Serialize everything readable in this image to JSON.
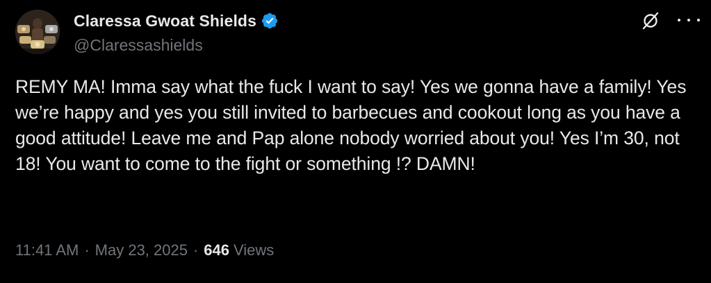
{
  "tweet": {
    "author": {
      "display_name": "Claressa Gwoat Shields",
      "handle": "@Claressashields",
      "verified": true
    },
    "text": "REMY MA! Imma say what the fuck I want to say! Yes we gonna have a family! Yes we’re happy and yes you still invited to barbecues and cookout long as you have a good attitude! Leave me and Pap alone nobody worried about you! Yes I’m 30, not 18! You want to come to the fight or something !? DAMN!",
    "time": "11:41 AM",
    "date": "May 23, 2025",
    "separator": "·",
    "views_count": "646",
    "views_label": "Views"
  },
  "icons": {
    "verified": "verified-badge-icon",
    "grok": "grok-icon",
    "more": "more-options-icon"
  },
  "colors": {
    "background": "#000000",
    "text_primary": "#e7e9ea",
    "text_secondary": "#71767b",
    "verified_blue": "#1d9bf0"
  }
}
